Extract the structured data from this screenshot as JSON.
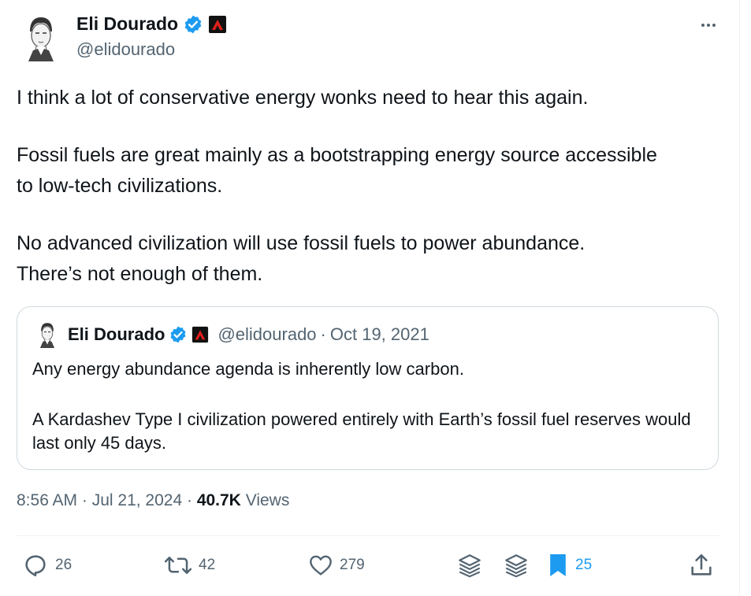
{
  "tweet": {
    "author": {
      "name": "Eli Dourado",
      "handle": "@elidourado"
    },
    "paragraphs": [
      "I think a lot of conservative energy wonks need to hear this again.",
      "Fossil fuels are great mainly as a bootstrapping energy source accessible\nto low-tech civilizations.",
      "No advanced civilization will use fossil fuels to power abundance.\nThere’s not enough of them."
    ],
    "timestamp": "8:56 AM · Jul 21, 2024 ·",
    "views_count": "40.7K",
    "views_label": "Views"
  },
  "quote": {
    "name": "Eli Dourado",
    "handle": "@elidourado",
    "separator": "·",
    "date": "Oct 19, 2021",
    "paragraphs": [
      "Any energy abundance agenda is inherently low carbon.",
      "A Kardashev Type I civilization powered entirely with Earth’s fossil fuel reserves would last only 45 days."
    ]
  },
  "actions": {
    "replies": "26",
    "reposts": "42",
    "likes": "279",
    "bookmarks": "25"
  },
  "icons": [
    "avatar",
    "verified-badge-icon",
    "org-badge-icon",
    "more-icon",
    "reply-icon",
    "repost-icon",
    "like-icon",
    "layers-icon",
    "bookmark-icon",
    "share-icon"
  ],
  "colors": {
    "accent": "#1d9bf0",
    "text": "#0f1419",
    "secondary": "#536471",
    "border": "#cfd9de"
  }
}
